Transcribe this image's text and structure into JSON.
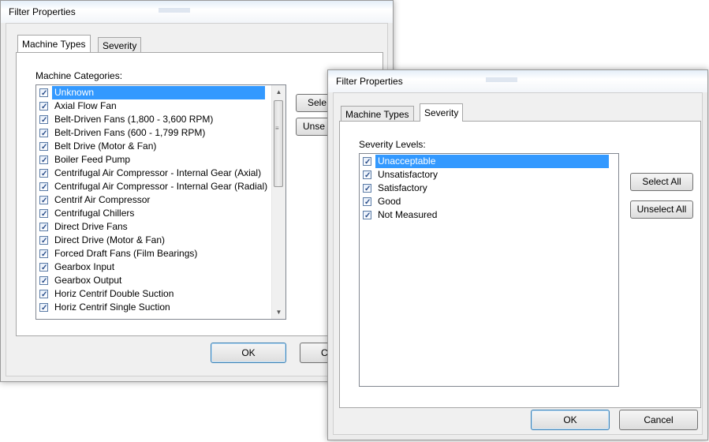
{
  "dialog1": {
    "title": "Filter Properties",
    "tabs": [
      {
        "label": "Machine Types",
        "active": true
      },
      {
        "label": "Severity",
        "active": false
      }
    ],
    "group_label": "Machine Categories:",
    "items": [
      {
        "label": "Unknown",
        "checked": true,
        "selected": true
      },
      {
        "label": "Axial Flow Fan",
        "checked": true
      },
      {
        "label": "Belt-Driven Fans (1,800 - 3,600 RPM)",
        "checked": true
      },
      {
        "label": "Belt-Driven Fans (600 - 1,799 RPM)",
        "checked": true
      },
      {
        "label": "Belt Drive (Motor & Fan)",
        "checked": true
      },
      {
        "label": "Boiler Feed Pump",
        "checked": true
      },
      {
        "label": "Centrifugal Air Compressor - Internal Gear (Axial)",
        "checked": true
      },
      {
        "label": "Centrifugal Air Compressor - Internal Gear (Radial)",
        "checked": true
      },
      {
        "label": "Centrif Air Compressor",
        "checked": true
      },
      {
        "label": "Centrifugal Chillers",
        "checked": true
      },
      {
        "label": "Direct Drive Fans",
        "checked": true
      },
      {
        "label": "Direct Drive (Motor & Fan)",
        "checked": true
      },
      {
        "label": "Forced Draft Fans (Film Bearings)",
        "checked": true
      },
      {
        "label": "Gearbox Input",
        "checked": true
      },
      {
        "label": "Gearbox Output",
        "checked": true
      },
      {
        "label": "Horiz Centrif Double Suction",
        "checked": true
      },
      {
        "label": "Horiz Centrif Single Suction",
        "checked": true
      }
    ],
    "select_all_label": "Sele",
    "unselect_all_label": "Unse",
    "ok_label": "OK",
    "cancel_label": "C"
  },
  "dialog2": {
    "title": "Filter Properties",
    "tabs": [
      {
        "label": "Machine Types",
        "active": false
      },
      {
        "label": "Severity",
        "active": true
      }
    ],
    "group_label": "Severity Levels:",
    "items": [
      {
        "label": "Unacceptable",
        "checked": true,
        "selected": true
      },
      {
        "label": "Unsatisfactory",
        "checked": true
      },
      {
        "label": "Satisfactory",
        "checked": true
      },
      {
        "label": "Good",
        "checked": true
      },
      {
        "label": "Not Measured",
        "checked": true
      }
    ],
    "select_all_label": "Select All",
    "unselect_all_label": "Unselect All",
    "ok_label": "OK",
    "cancel_label": "Cancel"
  },
  "colors": {
    "selection": "#3399ff",
    "dialog_bg": "#f0f0f0",
    "default_button_border": "#3c7fb1"
  },
  "icons": {
    "checkbox": "checkmark-icon",
    "scroll_up": "scroll-up-arrow-icon",
    "scroll_down": "scroll-down-arrow-icon"
  }
}
